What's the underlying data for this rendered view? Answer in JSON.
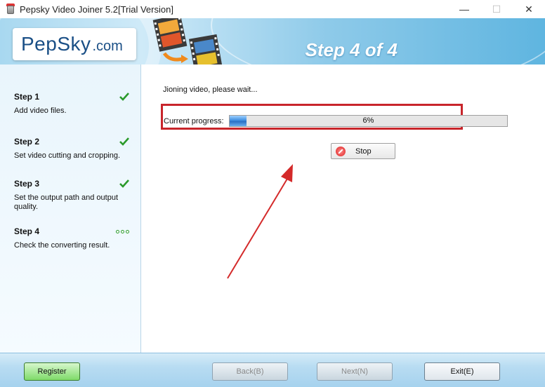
{
  "window": {
    "title": "Pepsky Video Joiner 5.2[Trial Version]",
    "minimize": "—",
    "maximize": "☐",
    "close": "✕"
  },
  "header": {
    "logo_brand": "PepSky",
    "logo_suffix": ".com",
    "step_title": "Step 4 of 4"
  },
  "sidebar": {
    "steps": [
      {
        "label": "Step 1",
        "desc": "Add video files.",
        "status": "check-icon"
      },
      {
        "label": "Step 2",
        "desc": "Set video cutting and cropping.",
        "status": "check-icon"
      },
      {
        "label": "Step 3",
        "desc": "Set the output path and output quality.",
        "status": "check-icon"
      },
      {
        "label": "Step 4",
        "desc": "Check the converting result.",
        "status": "in-progress-dots-icon"
      }
    ]
  },
  "main": {
    "status_message": "Jioning video, please wait...",
    "progress_label": "Current progress:",
    "progress_percent": 6,
    "progress_text": "6%",
    "stop_label": "Stop"
  },
  "footer": {
    "register_label": "Register",
    "back_label": "Back(B)",
    "next_label": "Next(N)",
    "exit_label": "Exit(E)"
  },
  "colors": {
    "highlight_box": "#c8252b",
    "annotation_arrow": "#d42a2a",
    "check": "#2a9a2a",
    "header_blue": "#5fb5e0"
  }
}
